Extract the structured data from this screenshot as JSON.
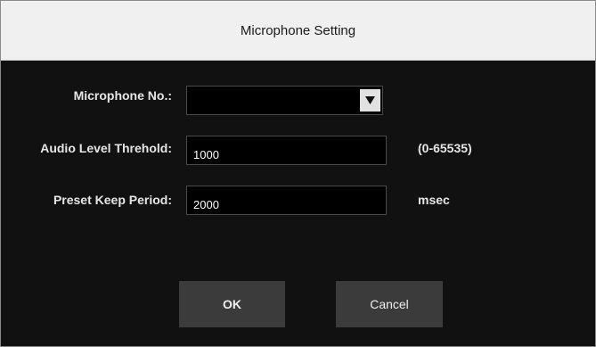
{
  "dialog": {
    "title": "Microphone Setting"
  },
  "form": {
    "microphone_no": {
      "label": "Microphone No.:",
      "value": ""
    },
    "audio_level": {
      "label": "Audio Level Threhold:",
      "value": "1000",
      "range_hint": "(0-65535)"
    },
    "preset_keep": {
      "label": "Preset Keep Period:",
      "value": "2000",
      "unit": "msec"
    }
  },
  "buttons": {
    "ok_label": "OK",
    "cancel_label": "Cancel"
  },
  "colors": {
    "background": "#111111",
    "titlebar": "#f0f0f0",
    "field": "#000000",
    "button": "#3b3b3b",
    "text": "#e6e6e6"
  },
  "icons": {
    "dropdown": "triangle-down-icon"
  }
}
